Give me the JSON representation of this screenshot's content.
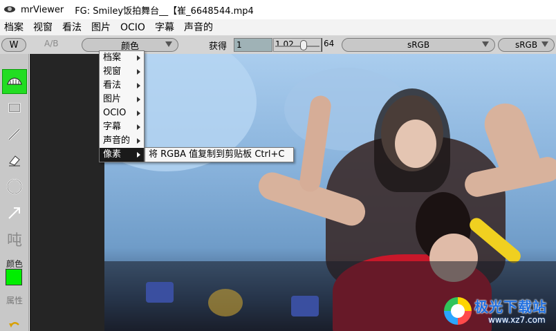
{
  "window": {
    "app_name": "mrViewer",
    "title": "FG: Smiley饭拍舞台__【崔_6648544.mp4"
  },
  "menubar": {
    "items": [
      "档案",
      "视窗",
      "看法",
      "图片",
      "OCIO",
      "字幕",
      "声音的"
    ]
  },
  "toolbar": {
    "wipe_label": "W",
    "ab_label": "A/B",
    "channel_label": "颜色",
    "gain_label": "获得",
    "gain_value": "1",
    "gamma_value": "1.02",
    "fstop_value": "64",
    "input_colorspace": "sRGB",
    "display_colorspace": "sRGB"
  },
  "sidebar": {
    "text_tool_glyph": "吨",
    "color_label": "颜色",
    "color_value": "#00ee00",
    "properties_label": "属性"
  },
  "context_menu": {
    "items": [
      {
        "label": "档案"
      },
      {
        "label": "视窗"
      },
      {
        "label": "看法"
      },
      {
        "label": "图片"
      },
      {
        "label": "OCIO"
      },
      {
        "label": "字幕"
      },
      {
        "label": "声音的"
      },
      {
        "label": "像素"
      }
    ],
    "selected_index": 7,
    "submenu_item": "将 RGBA 值复制到剪贴板 Ctrl+C"
  },
  "watermark": {
    "name": "极光下载站",
    "url": "www.xz7.com"
  }
}
